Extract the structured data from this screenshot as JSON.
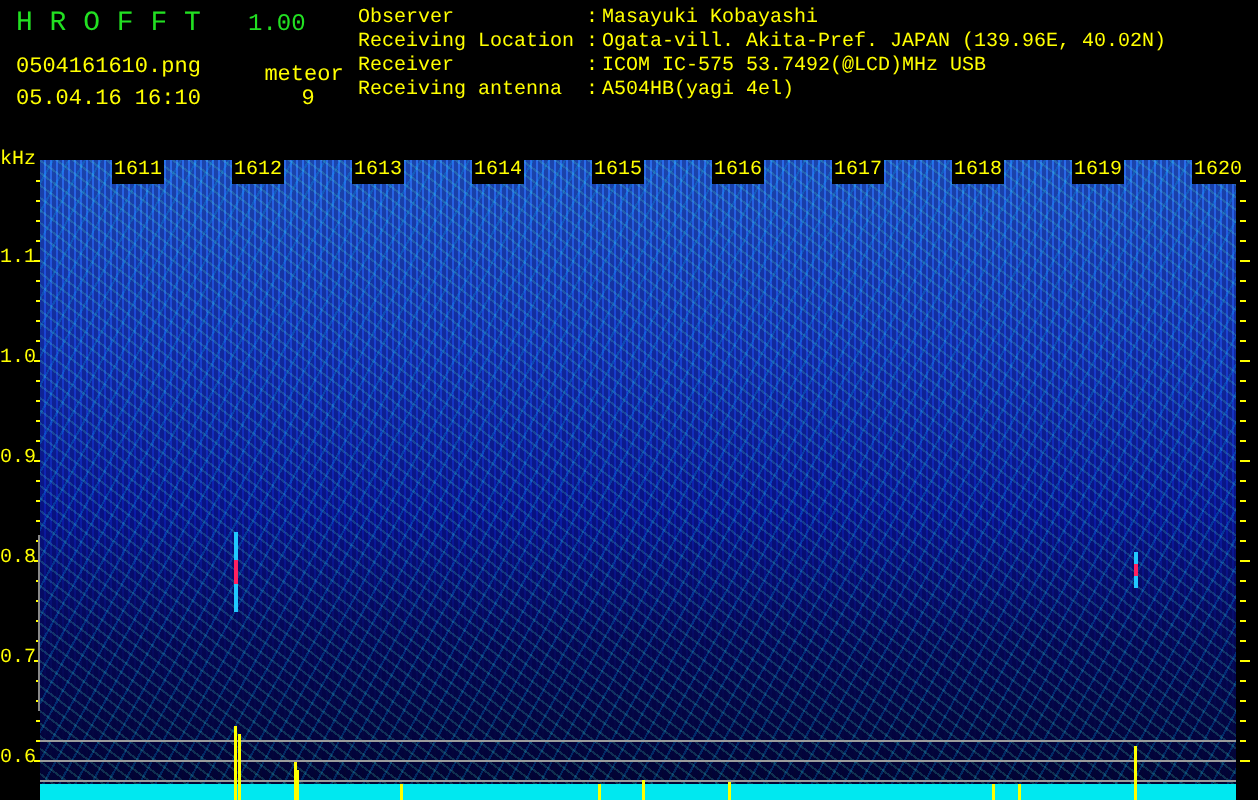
{
  "app": {
    "name": "H R O F F T",
    "version": "1.00"
  },
  "file_name": "0504161610.png",
  "timestamp": "05.04.16 16:10",
  "meteor": {
    "label": "meteor",
    "count": "9"
  },
  "info": [
    {
      "label": "Observer",
      "separator": ":",
      "value": "Masayuki Kobayashi"
    },
    {
      "label": "Receiving Location",
      "separator": ":",
      "value": "Ogata-vill. Akita-Pref. JAPAN (139.96E, 40.02N)"
    },
    {
      "label": "Receiver",
      "separator": ":",
      "value": "ICOM IC-575 53.7492(@LCD)MHz USB"
    },
    {
      "label": "Receiving antenna",
      "separator": ":",
      "value": "A504HB(yagi 4el)"
    }
  ],
  "spectrogram": {
    "unit": "kHz",
    "y_labels": [
      "1.1",
      "1.0",
      "0.9",
      "0.8",
      "0.7",
      "0.6"
    ],
    "time_labels": [
      "1611",
      "1612",
      "1613",
      "1614",
      "1615",
      "1616",
      "1617",
      "1618",
      "1619",
      "1620"
    ]
  }
}
